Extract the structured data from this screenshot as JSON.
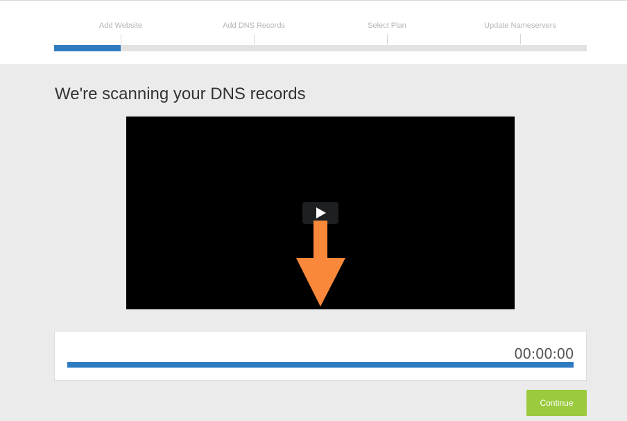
{
  "steps": {
    "items": [
      {
        "label": "Add Website"
      },
      {
        "label": "Add DNS Records"
      },
      {
        "label": "Select Plan"
      },
      {
        "label": "Update Nameservers"
      }
    ],
    "progress_fraction": 0.125,
    "active_color": "#2f7bc1"
  },
  "main": {
    "title": "We're scanning your DNS records"
  },
  "video": {
    "play_icon": "play-icon",
    "overlay_icon": "down-arrow-icon",
    "arrow_color": "#f9883a"
  },
  "scan": {
    "elapsed": "00:00:00",
    "progress_fraction": 1.0
  },
  "actions": {
    "continue_label": "Continue",
    "continue_color": "#9bca3e"
  }
}
